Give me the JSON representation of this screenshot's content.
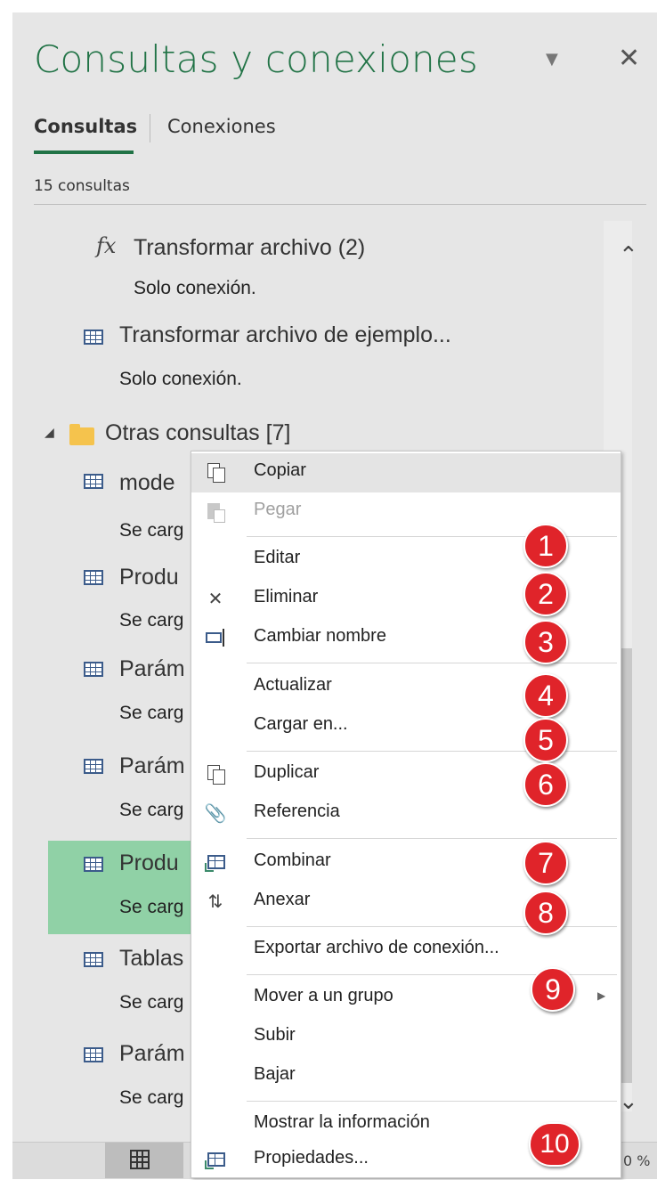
{
  "header": {
    "title": "Consultas y conexiones",
    "caret_icon": "caret-down-icon",
    "close_icon": "close-icon"
  },
  "tabs": [
    {
      "label": "Consultas",
      "active": true
    },
    {
      "label": "Conexiones",
      "active": false
    }
  ],
  "query_count": "15 consultas",
  "queries": [
    {
      "name": "Transformar archivo (2)",
      "status": "Solo conexión.",
      "icon": "function-icon"
    },
    {
      "name": "Transformar archivo de ejemplo...",
      "status": "Solo conexión.",
      "icon": "table-icon"
    }
  ],
  "group": {
    "name": "Otras consultas [7]",
    "icon": "folder-icon"
  },
  "group_items": [
    {
      "name": "mode",
      "status": "Se carg"
    },
    {
      "name": "Produ",
      "status": "Se carg"
    },
    {
      "name": "Parám",
      "status": "Se carg"
    },
    {
      "name": "Parám",
      "status": "Se carg"
    },
    {
      "name": "Produ",
      "status": "Se carg",
      "selected": true
    },
    {
      "name": "Tablas",
      "status": "Se carg"
    },
    {
      "name": "Parám",
      "status": "Se carg"
    }
  ],
  "context_menu": {
    "items": [
      {
        "label": "Copiar",
        "icon": "copy-icon"
      },
      {
        "label": "Pegar",
        "icon": "paste-icon",
        "disabled": true
      },
      {
        "label": "Editar"
      },
      {
        "label": "Eliminar",
        "icon": "delete-icon"
      },
      {
        "label": "Cambiar nombre",
        "icon": "rename-icon"
      },
      {
        "label": "Actualizar"
      },
      {
        "label": "Cargar en..."
      },
      {
        "label": "Duplicar",
        "icon": "duplicate-icon"
      },
      {
        "label": "Referencia",
        "icon": "paperclip-icon"
      },
      {
        "label": "Combinar",
        "icon": "merge-icon"
      },
      {
        "label": "Anexar",
        "icon": "append-icon"
      },
      {
        "label": "Exportar archivo de conexión..."
      },
      {
        "label": "Mover a un grupo",
        "has_submenu": true
      },
      {
        "label": "Subir"
      },
      {
        "label": "Bajar"
      },
      {
        "label": "Mostrar la información"
      },
      {
        "label": "Propiedades...",
        "icon": "properties-icon"
      }
    ],
    "badges": [
      "1",
      "2",
      "3",
      "4",
      "5",
      "6",
      "7",
      "8",
      "9",
      "10"
    ]
  },
  "statusbar": {
    "zoom_fragment": "0 %"
  },
  "colors": {
    "accent": "#217346",
    "badge": "#e0242a",
    "selection": "#90d1a6"
  }
}
